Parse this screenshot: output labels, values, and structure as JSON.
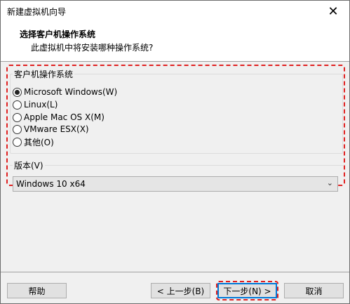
{
  "window": {
    "title": "新建虚拟机向导",
    "close_glyph": "✕"
  },
  "header": {
    "title": "选择客户机操作系统",
    "subtitle": "此虚拟机中将安装哪种操作系统?"
  },
  "os_group": {
    "label": "客户机操作系统",
    "options": [
      {
        "label": "Microsoft Windows(W)",
        "selected": true
      },
      {
        "label": "Linux(L)",
        "selected": false
      },
      {
        "label": "Apple Mac OS X(M)",
        "selected": false
      },
      {
        "label": "VMware ESX(X)",
        "selected": false
      },
      {
        "label": "其他(O)",
        "selected": false
      }
    ]
  },
  "version": {
    "label": "版本(V)",
    "selected": "Windows 10 x64"
  },
  "buttons": {
    "help": "帮助",
    "back": "< 上一步(B)",
    "next": "下一步(N) >",
    "cancel": "取消"
  },
  "colors": {
    "highlight": "#e02020",
    "focus": "#0078d7"
  }
}
